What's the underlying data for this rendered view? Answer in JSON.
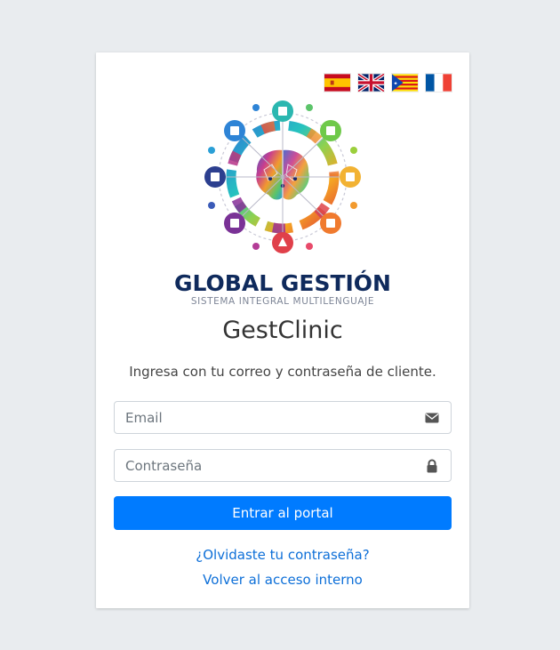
{
  "languages": [
    {
      "code": "es",
      "icon": "spain-flag-icon"
    },
    {
      "code": "en",
      "icon": "uk-flag-icon"
    },
    {
      "code": "ca",
      "icon": "catalonia-flag-icon"
    },
    {
      "code": "fr",
      "icon": "france-flag-icon"
    }
  ],
  "logo": {
    "brand": "GLOBAL GESTIÓN",
    "tagline": "SISTEMA INTEGRAL MULTILENGUAJE",
    "icon": "brain-network-icon"
  },
  "app_title": "GestClinic",
  "subtitle": "Ingresa con tu correo y contraseña de cliente.",
  "form": {
    "email_placeholder": "Email",
    "email_value": "",
    "email_icon": "envelope-icon",
    "password_placeholder": "Contraseña",
    "password_value": "",
    "password_icon": "lock-icon",
    "submit_label": "Entrar al portal"
  },
  "links": {
    "forgot": "¿Olvidaste tu contraseña?",
    "internal": "Volver al acceso interno"
  },
  "colors": {
    "background": "#e9ecef",
    "primary": "#007bff",
    "link": "#0d6fd8",
    "brand_navy": "#0f2a5c"
  }
}
